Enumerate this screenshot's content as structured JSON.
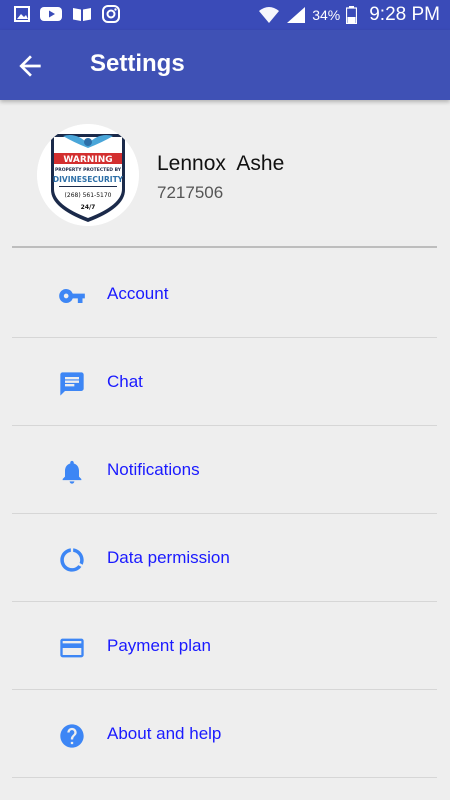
{
  "status_bar": {
    "battery_percent": "34%",
    "time": "9:28 PM",
    "icons": [
      "gallery-icon",
      "youtube-icon",
      "news-icon",
      "instagram-icon",
      "wifi-icon",
      "signal-icon",
      "battery-icon"
    ]
  },
  "app_bar": {
    "title": "Settings",
    "back_icon": "arrow-back-icon"
  },
  "profile": {
    "name": "Lennox  Ashe",
    "id": "7217506",
    "avatar": {
      "warning": "WARNING",
      "line1": "PROPERTY PROTECTED BY",
      "brand": "DIVINESECURITY",
      "phone": "(268) 561-5170",
      "hours": "24/7"
    }
  },
  "menu": [
    {
      "label": "Account",
      "icon": "key-icon"
    },
    {
      "label": "Chat",
      "icon": "chat-icon"
    },
    {
      "label": "Notifications",
      "icon": "bell-icon"
    },
    {
      "label": "Data permission",
      "icon": "data-usage-icon"
    },
    {
      "label": "Payment plan",
      "icon": "credit-card-icon"
    },
    {
      "label": "About and help",
      "icon": "help-icon"
    }
  ],
  "colors": {
    "app_bar": "#3f51b5",
    "status_bar": "#3a4bb8",
    "icon_blue": "#3d86f5",
    "label_blue": "#1a1aff",
    "background": "#eeeeee"
  }
}
